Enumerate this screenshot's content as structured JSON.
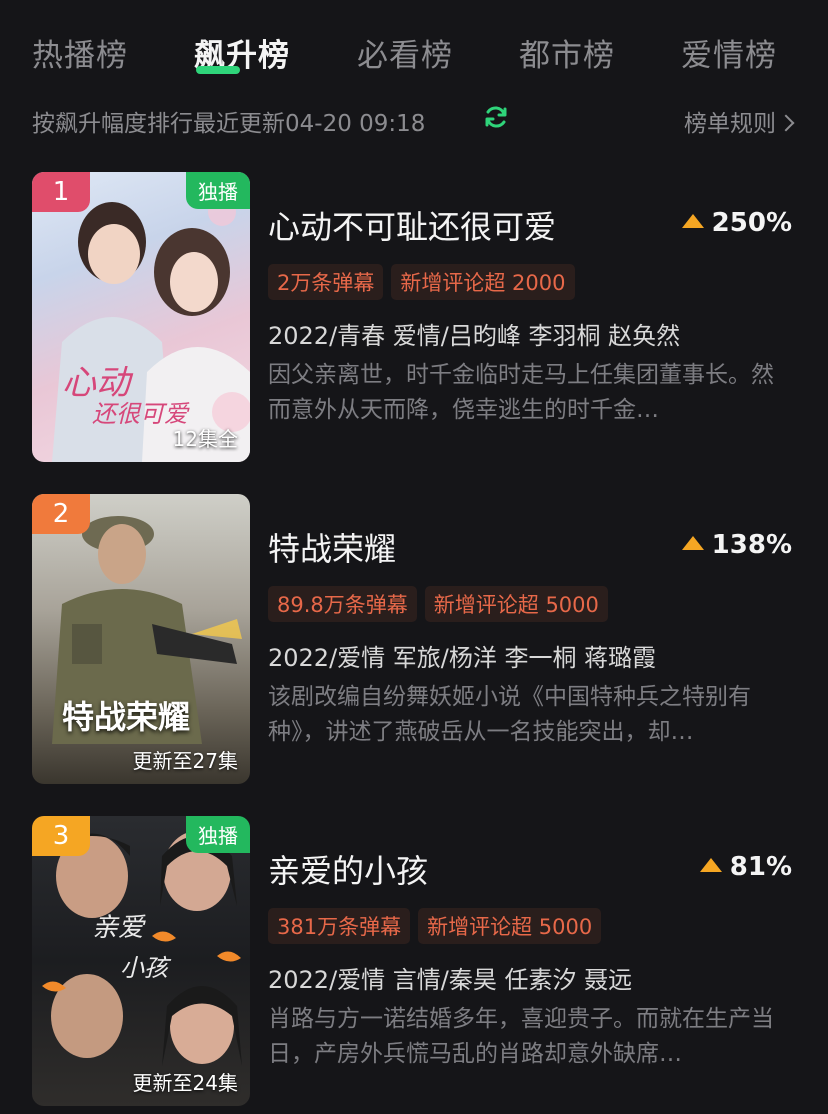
{
  "tabs": [
    "热播榜",
    "飙升榜",
    "必看榜",
    "都市榜",
    "爱情榜"
  ],
  "subbar": {
    "desc": "按飙升幅度排行最近更新04-20 09:18",
    "rules": "榜单规则"
  },
  "colors": {
    "accent": "#2fd47a",
    "rank_1": "#e04d6b",
    "rank_2": "#f07a3c",
    "rank_3": "#f5a623",
    "rise_arrow": "#f5a623",
    "tag_text": "#e76849"
  },
  "icons": {
    "refresh": "refresh-icon",
    "rules": "chevron-right-icon",
    "rise": "triangle-up-icon"
  },
  "items": [
    {
      "rank": "1",
      "badge": "独播",
      "episodes": "12集全",
      "title": "心动不可耻还很可爱",
      "rise": "250%",
      "tags": [
        "2万条弹幕",
        "新增评论超 2000"
      ],
      "meta": "2022/青春 爱情/吕昀峰 李羽桐 赵奂然",
      "desc": "因父亲离世，时千金临时走马上任集团董事长。然而意外从天而降，侥幸逃生的时千金…"
    },
    {
      "rank": "2",
      "badge": "",
      "episodes": "更新至27集",
      "poster_title": "特战荣耀",
      "title": "特战荣耀",
      "rise": "138%",
      "tags": [
        "89.8万条弹幕",
        "新增评论超 5000"
      ],
      "meta": "2022/爱情 军旅/杨洋 李一桐 蒋璐霞",
      "desc": "该剧改编自纷舞妖姬小说《中国特种兵之特别有种》，讲述了燕破岳从一名技能突出，却…"
    },
    {
      "rank": "3",
      "badge": "独播",
      "episodes": "更新至24集",
      "title": "亲爱的小孩",
      "rise": "81%",
      "tags": [
        "381万条弹幕",
        "新增评论超 5000"
      ],
      "meta": "2022/爱情 言情/秦昊 任素汐 聂远",
      "desc": "肖路与方一诺结婚多年，喜迎贵子。而就在生产当日，产房外兵慌马乱的肖路却意外缺席…"
    }
  ]
}
